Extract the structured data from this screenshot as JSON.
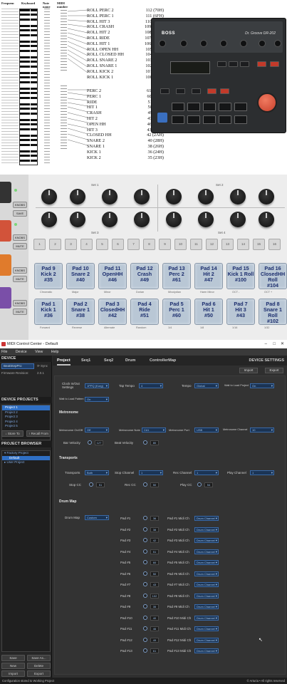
{
  "chart": {
    "head_freq": "Frequenc",
    "head_keyboard": "Keyboard",
    "head_note": "Note name",
    "head_midi": "MIDI number",
    "roll_map": [
      {
        "name": "ROLL PERC 2",
        "num": "112 (70H)"
      },
      {
        "name": "ROLL PERC 1",
        "num": "111 (6FH)"
      },
      {
        "name": "ROLL HIT 3",
        "num": "110 (6EH)"
      },
      {
        "name": "ROLL CRASH",
        "num": "109 (6DH)"
      },
      {
        "name": "ROLL HIT 2",
        "num": "108 (6CH)"
      },
      {
        "name": "ROLL RIDE",
        "num": "107 (6BH)"
      },
      {
        "name": "ROLL HIT 1",
        "num": "106 (6AH)"
      },
      {
        "name": "ROLL OPEN HH",
        "num": "105 (69H)"
      },
      {
        "name": "ROLL CLOSED HH",
        "num": "104 (68H)"
      },
      {
        "name": "ROLL SNARE 2",
        "num": "103 (67H)"
      },
      {
        "name": "ROLL SNARE 1",
        "num": "102 (66H)"
      },
      {
        "name": "ROLL KICK 2",
        "num": "101 (65H)"
      },
      {
        "name": "ROLL KICK 1",
        "num": "100 (64H)"
      }
    ],
    "main_map": [
      {
        "name": "PERC 2",
        "num": "61 (3DH)"
      },
      {
        "name": "PERC 1",
        "num": "60 (3CH)"
      },
      {
        "name": "RIDE",
        "num": "51 (33H)"
      },
      {
        "name": "HIT 1",
        "num": "50 (32H)"
      },
      {
        "name": "CRASH",
        "num": "49 (31H)"
      },
      {
        "name": "HIT 2",
        "num": "47 (2FH)"
      },
      {
        "name": "OPEN HH",
        "num": "46 (2EH)"
      },
      {
        "name": "HIT 3",
        "num": "43 (2BH)"
      },
      {
        "name": "CLOSED HH",
        "num": "42 (2AH)"
      },
      {
        "name": "SNARE 2",
        "num": "40 (28H)"
      },
      {
        "name": "SNARE 1",
        "num": "38 (26H)"
      },
      {
        "name": "KICK 1",
        "num": "36 (24H)"
      },
      {
        "name": "KICK 2",
        "num": "35 (23H)"
      }
    ]
  },
  "drum_machine": {
    "brand": "BOSS",
    "model": "Dr. Groove DR-202"
  },
  "beatstep": {
    "set1": "Set 1",
    "set2": "Set 2",
    "set3": "Set 3",
    "set4": "Set 4",
    "knobs_label": "KNOBS",
    "save_label": "SAVE",
    "mute_label": "MUTE",
    "steps": [
      "1",
      "2",
      "3",
      "4",
      "5",
      "6",
      "7",
      "8",
      "9",
      "10",
      "11",
      "12",
      "13",
      "14",
      "15",
      "16"
    ],
    "pads_top": [
      {
        "line1": "Pad 9",
        "line2": "Kick 2",
        "line3": "#35",
        "sub": "Chromatic"
      },
      {
        "line1": "Pad 10",
        "line2": "Snare 2",
        "line3": "#40",
        "sub": "Major"
      },
      {
        "line1": "Pad 11",
        "line2": "OpenHH",
        "line3": "#46",
        "sub": "Minor"
      },
      {
        "line1": "Pad 12",
        "line2": "Crash",
        "line3": "#49",
        "sub": "Dorian"
      },
      {
        "line1": "Pad 13",
        "line2": "Perc 2",
        "line3": "#61",
        "sub": "Mixolydian"
      },
      {
        "line1": "Pad 14",
        "line2": "Hit 2",
        "line3": "#47",
        "sub": "Harm Minor"
      },
      {
        "line1": "Pad 15",
        "line2": "Kick 1 Roll",
        "line3": "#100",
        "sub": "OCT -"
      },
      {
        "line1": "Pad 16",
        "line2": "ClosedHH Roll",
        "line3": "#104",
        "sub": "OCT +"
      }
    ],
    "pads_bottom": [
      {
        "line1": "Pad 1",
        "line2": "Kick 1",
        "line3": "#36",
        "sub": "Forward"
      },
      {
        "line1": "Pad 2",
        "line2": "Snare 1",
        "line3": "#38",
        "sub": "Reverse"
      },
      {
        "line1": "Pad 3",
        "line2": "ClosedHH",
        "line3": "#42",
        "sub": "Alternate"
      },
      {
        "line1": "Pad 4",
        "line2": "Ride",
        "line3": "#51",
        "sub": "Random"
      },
      {
        "line1": "Pad 5",
        "line2": "Perc 1",
        "line3": "#60",
        "sub": "1/4"
      },
      {
        "line1": "Pad 6",
        "line2": "Hit 1",
        "line3": "#50",
        "sub": "1/8"
      },
      {
        "line1": "Pad 7",
        "line2": "Hit 3",
        "line3": "#43",
        "sub": "1/16"
      },
      {
        "line1": "Pad 8",
        "line2": "Snare 1 Roll",
        "line3": "#102",
        "sub": "1/32"
      }
    ]
  },
  "mcc": {
    "title": "MIDI Control Center - Default",
    "menu": [
      "File",
      "Device",
      "View",
      "Help"
    ],
    "sidebar": {
      "device_header": "DEVICE",
      "device_value": "BeatStepPro",
      "sync_label": "Sync",
      "firmware_label": "Firmware Revision:",
      "firmware_value": "2.0.1",
      "projects_header": "DEVICE PROJECTS",
      "projects": [
        "Project 1",
        "Project 2",
        "Project 3",
        "Project 4",
        "Project 5"
      ],
      "store_btn": "Store To",
      "recall_btn": "Recall From",
      "browser_header": "PROJECT BROWSER",
      "tree": [
        "Factory Project",
        "Default",
        "User Project"
      ],
      "save_btn": "Save",
      "save_as_btn": "Save As...",
      "new_btn": "New",
      "delete_btn": "Delete",
      "import_btn": "Import",
      "export_btn": "Export"
    },
    "tabs": [
      "Project",
      "Seq1",
      "Seq2",
      "Drum",
      "ControllerMap"
    ],
    "device_settings": "DEVICE SETTINGS",
    "import_btn": "Import",
    "export_btn": "Export",
    "clock_label": "Clock In/Out Settings",
    "clock_value": "1PPQ (Korg)",
    "tap_label": "Tap Tempo",
    "tap_value": "4",
    "tempo_label": "Tempo",
    "tempo_value": "Global",
    "wait_load_proj_label": "Wait to Load Project",
    "wait_load_proj_value": "On",
    "wait_load_pattern_label": "Wait to Load Pattern",
    "wait_load_pattern_value": "On",
    "metronome_title": "Metronome",
    "met_on_label": "Metronome On/Off",
    "met_on_value": "Off",
    "met_note_label": "Metronome Note",
    "met_note_value": "C#1",
    "met_port_label": "Metronome Port",
    "met_port_value": "USB",
    "met_channel_label": "Metronome Channel",
    "met_channel_value": "10",
    "bar_vel_label": "Bar Velocity",
    "bar_vel_value": "127",
    "beat_vel_label": "Beat Velocity",
    "beat_vel_value": "80",
    "transports_title": "Transports",
    "transports_label": "Transports",
    "transports_value": "Both",
    "stop_ch_label": "Stop Channel",
    "stop_ch_value": "1",
    "rec_ch_label": "Rec Channel",
    "rec_ch_value": "1",
    "play_ch_label": "Play Channel",
    "play_ch_value": "1",
    "stop_cc_label": "Stop CC",
    "stop_cc_value": "51",
    "rec_cc_label": "Rec CC",
    "rec_cc_value": "50",
    "play_cc_label": "Play CC",
    "play_cc_value": "54",
    "drum_map_title": "Drum Map",
    "drum_map_label": "Drum Map",
    "drum_map_value": "Custom",
    "pads": [
      {
        "label": "Pad #1",
        "note": "36",
        "ch_label": "Pad #1 Midi Ch",
        "ch": "Drum Channel"
      },
      {
        "label": "Pad #2",
        "note": "38",
        "ch_label": "Pad #2 Midi Ch",
        "ch": "Drum Channel"
      },
      {
        "label": "Pad #3",
        "note": "42",
        "ch_label": "Pad #3 Midi Ch",
        "ch": "Drum Channel"
      },
      {
        "label": "Pad #4",
        "note": "51",
        "ch_label": "Pad #4 Midi Ch",
        "ch": "Drum Channel"
      },
      {
        "label": "Pad #5",
        "note": "60",
        "ch_label": "Pad #5 Midi Ch",
        "ch": "Drum Channel"
      },
      {
        "label": "Pad #6",
        "note": "50",
        "ch_label": "Pad #6 Midi Ch",
        "ch": "Drum Channel"
      },
      {
        "label": "Pad #7",
        "note": "43",
        "ch_label": "Pad #7 Midi Ch",
        "ch": "Drum Channel"
      },
      {
        "label": "Pad #8",
        "note": "102",
        "ch_label": "Pad #8 Midi Ch",
        "ch": "Drum Channel"
      },
      {
        "label": "Pad #9",
        "note": "35",
        "ch_label": "Pad #9 Midi Ch",
        "ch": "Drum Channel"
      },
      {
        "label": "Pad #10",
        "note": "40",
        "ch_label": "Pad #10 Midi Ch",
        "ch": "Drum Channel"
      },
      {
        "label": "Pad #11",
        "note": "46",
        "ch_label": "Pad #11 Midi Ch",
        "ch": "Drum Channel"
      },
      {
        "label": "Pad #12",
        "note": "49",
        "ch_label": "Pad #12 Midi Ch",
        "ch": "Drum Channel"
      },
      {
        "label": "Pad #13",
        "note": "61",
        "ch_label": "Pad #13 Midi Ch",
        "ch": "Drum Channel"
      }
    ],
    "status_left": "Configuration stored to Working Project",
    "status_right": "© Arturia • All rights reserved"
  }
}
